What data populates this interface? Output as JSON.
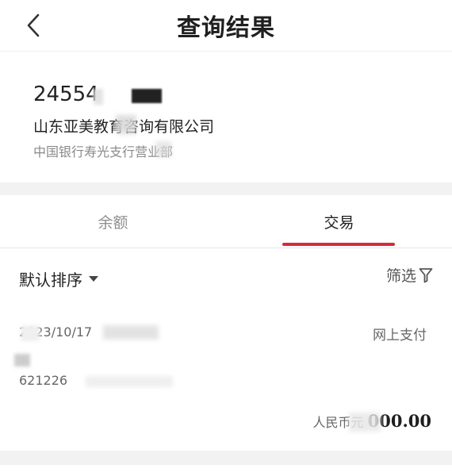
{
  "header": {
    "title": "查询结果",
    "back_icon": "chevron-left-icon"
  },
  "account": {
    "number": "24554",
    "company_name": "山东亚美教育咨询有限公司",
    "branch": "中国银行寿光支行营业部"
  },
  "tabs": [
    {
      "label": "余额",
      "active": false
    },
    {
      "label": "交易",
      "active": true
    }
  ],
  "sort": {
    "label": "默认排序",
    "icon": "caret-down-icon"
  },
  "filter": {
    "label": "筛选",
    "icon": "funnel-icon"
  },
  "transaction": {
    "date": "2023/10/17",
    "type": "网上支付",
    "card_no": "621226",
    "amount_label": "人民币元",
    "amount": "000.00"
  },
  "colors": {
    "accent": "#d42a3a",
    "background_gap": "#f2f2f2"
  }
}
